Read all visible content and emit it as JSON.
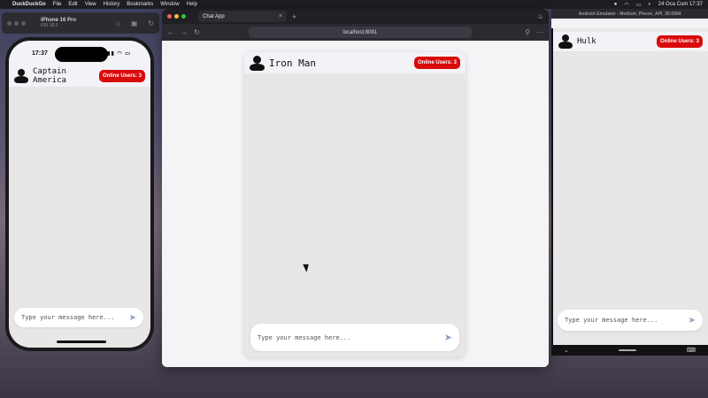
{
  "menubar": {
    "app_name": "DuckDuckGo",
    "items": [
      "File",
      "Edit",
      "View",
      "History",
      "Bookmarks",
      "Window",
      "Help"
    ],
    "clock": "24 Oca Cum  17:37"
  },
  "simulator": {
    "device": "iPhone 16 Pro",
    "os": "iOS 18.2"
  },
  "ios": {
    "time": "17:37",
    "user": "Captain America",
    "badge": "Online Users: 3",
    "placeholder": "Type your message here..."
  },
  "browser": {
    "tab_title": "Chat App",
    "url": "localhost:8081",
    "user": "Iron Man",
    "badge": "Online Users: 3",
    "placeholder": "Type your message here..."
  },
  "android": {
    "window_title": "Android Emulator - Medium_Phone_API_35:5554",
    "user": "Hulk",
    "badge": "Online Users: 3",
    "placeholder": "Type your message here..."
  },
  "colors": {
    "badge_red": "#d90a0a",
    "chat_bg": "#e8e6e6",
    "header_bg": "#f3f2f7",
    "send_icon": "#8fa1c4"
  },
  "icons": {
    "avatar": "person-icon",
    "send": "send-icon"
  }
}
